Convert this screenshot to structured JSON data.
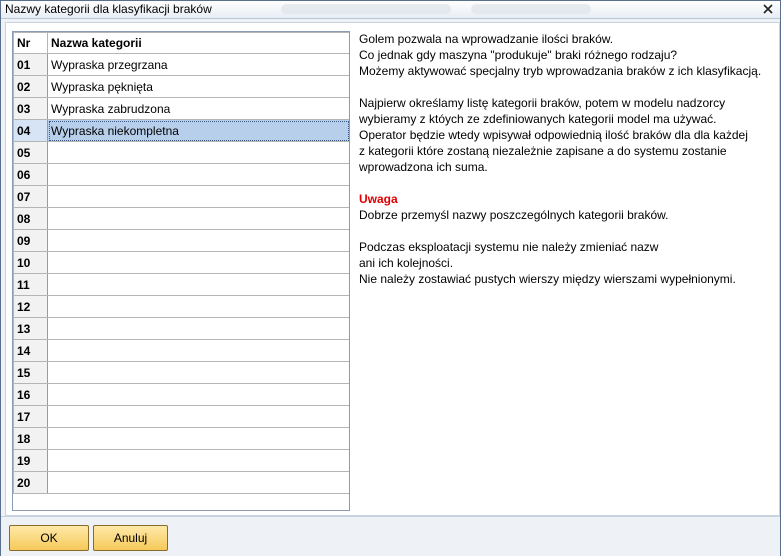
{
  "window": {
    "title": "Nazwy kategorii dla klasyfikacji braków",
    "close_icon": "close-icon"
  },
  "grid": {
    "headers": {
      "nr": "Nr",
      "name": "Nazwa kategorii"
    },
    "selected_row_index": 3,
    "rows": [
      {
        "nr": "01",
        "name": "Wypraska przegrzana"
      },
      {
        "nr": "02",
        "name": "Wypraska pęknięta"
      },
      {
        "nr": "03",
        "name": "Wypraska zabrudzona"
      },
      {
        "nr": "04",
        "name": "Wypraska niekompletna"
      },
      {
        "nr": "05",
        "name": ""
      },
      {
        "nr": "06",
        "name": ""
      },
      {
        "nr": "07",
        "name": ""
      },
      {
        "nr": "08",
        "name": ""
      },
      {
        "nr": "09",
        "name": ""
      },
      {
        "nr": "10",
        "name": ""
      },
      {
        "nr": "11",
        "name": ""
      },
      {
        "nr": "12",
        "name": ""
      },
      {
        "nr": "13",
        "name": ""
      },
      {
        "nr": "14",
        "name": ""
      },
      {
        "nr": "15",
        "name": ""
      },
      {
        "nr": "16",
        "name": ""
      },
      {
        "nr": "17",
        "name": ""
      },
      {
        "nr": "18",
        "name": ""
      },
      {
        "nr": "19",
        "name": ""
      },
      {
        "nr": "20",
        "name": ""
      }
    ]
  },
  "info": {
    "para1": [
      "Golem pozwala na wprowadzanie ilości braków.",
      "Co jednak gdy maszyna \"produkuje\" braki różnego rodzaju?",
      "Możemy aktywować specjalny tryb wprowadzania braków z ich klasyfikacją."
    ],
    "para2": [
      "Najpierw określamy listę kategorii braków, potem w modelu nadzorcy",
      "wybieramy z któych ze zdefiniowanych kategorii model ma używać.",
      "Operator będzie wtedy wpisywał odpowiednią ilość braków dla dla każdej",
      "z kategorii które zostaną niezależnie zapisane a do systemu zostanie",
      "wprowadzona ich suma."
    ],
    "warning_title": "Uwaga",
    "warning_text": "Dobrze przemyśl nazwy poszczególnych kategorii braków.",
    "para3": [
      "Podczas eksploatacji systemu nie należy zmieniać nazw",
      "ani ich kolejności.",
      "Nie należy zostawiać pustych wierszy między wierszami wypełnionymi."
    ],
    "warning_color": "#e00000"
  },
  "buttons": {
    "ok": "OK",
    "cancel": "Anuluj"
  }
}
